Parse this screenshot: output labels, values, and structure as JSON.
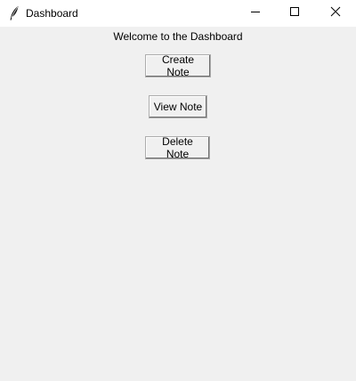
{
  "window": {
    "title": "Dashboard",
    "icon": "feather-icon",
    "controls": [
      "minimize-icon",
      "maximize-icon",
      "close-icon"
    ]
  },
  "main": {
    "welcome_text": "Welcome to the Dashboard",
    "buttons": {
      "create_label": "Create Note",
      "view_label": "View Note",
      "delete_label": "Delete Note"
    }
  },
  "colors": {
    "background": "#f0f0f0",
    "titlebar": "#ffffff",
    "button_border": "#adadad"
  }
}
